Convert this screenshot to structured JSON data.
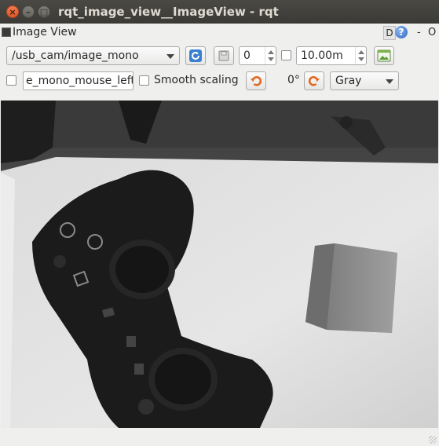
{
  "window": {
    "title": "rqt_image_view__ImageView - rqt"
  },
  "dock": {
    "title": "Image View",
    "d_label": "D",
    "help_label": "?",
    "minus_label": "-",
    "close_label": "O"
  },
  "toolbar": {
    "topic": "/usb_cam/image_mono",
    "spin_value": "0",
    "timeout_value": "10.00m",
    "mouse_topic": "e_mono_mouse_left",
    "smooth_label": "Smooth scaling",
    "rotation": "0°",
    "color_scheme": "Gray"
  },
  "colors": {
    "titlebar": "#3b3a36",
    "panel": "#efefee",
    "close_button": "#e0562a"
  }
}
